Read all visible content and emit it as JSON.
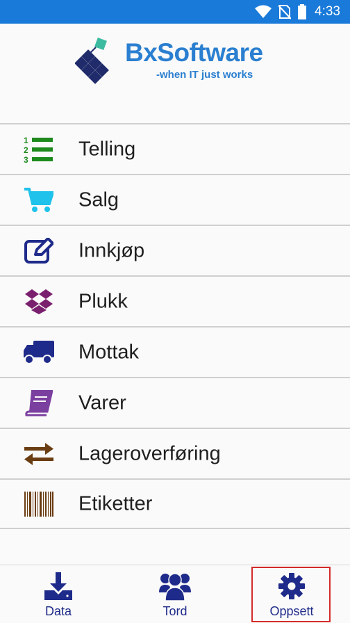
{
  "status_bar": {
    "time": "4:33",
    "icons": [
      "wifi-icon",
      "no-sim-icon",
      "battery-icon"
    ],
    "color": "#1a7ad9"
  },
  "logo": {
    "brand": "BxSoftware",
    "tagline": "-when IT just works"
  },
  "menu": {
    "items": [
      {
        "label": "Telling",
        "icon": "numbered-list-icon",
        "color": "#1e8a1e"
      },
      {
        "label": "Salg",
        "icon": "shopping-cart-icon",
        "color": "#1ec2ea"
      },
      {
        "label": "Innkjøp",
        "icon": "edit-icon",
        "color": "#1f2b8a"
      },
      {
        "label": "Plukk",
        "icon": "dropbox-icon",
        "color": "#7a1f6e"
      },
      {
        "label": "Mottak",
        "icon": "truck-icon",
        "color": "#1f2b8a"
      },
      {
        "label": "Varer",
        "icon": "book-icon",
        "color": "#7b3fa0"
      },
      {
        "label": "Lageroverføring",
        "icon": "exchange-icon",
        "color": "#6b3d12"
      },
      {
        "label": "Etiketter",
        "icon": "barcode-icon",
        "color": "#6b3d12"
      }
    ]
  },
  "bottom_nav": {
    "items": [
      {
        "label": "Data",
        "icon": "download-icon"
      },
      {
        "label": "Tord",
        "icon": "users-icon"
      },
      {
        "label": "Oppsett",
        "icon": "gear-icon",
        "selected": true
      }
    ],
    "color": "#1f2b8a",
    "highlight_color": "#d32b2b"
  }
}
